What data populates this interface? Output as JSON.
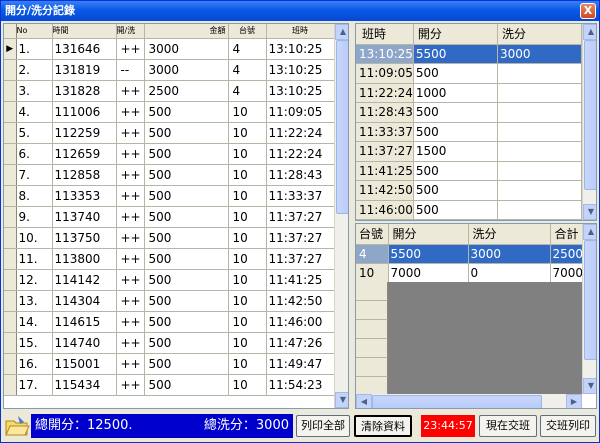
{
  "window": {
    "title": "開分/洗分記錄",
    "close_label": "X"
  },
  "left_table": {
    "headers": [
      "No",
      "時間",
      "開/洗",
      "金額",
      "台號",
      "班時"
    ],
    "rows": [
      [
        "1.",
        "131646",
        "++",
        "3000",
        "4",
        "13:10:25"
      ],
      [
        "2.",
        "131819",
        "--",
        "3000",
        "4",
        "13:10:25"
      ],
      [
        "3.",
        "131828",
        "++",
        "2500",
        "4",
        "13:10:25"
      ],
      [
        "4.",
        "111006",
        "++",
        "500",
        "10",
        "11:09:05"
      ],
      [
        "5.",
        "112259",
        "++",
        "500",
        "10",
        "11:22:24"
      ],
      [
        "6.",
        "112659",
        "++",
        "500",
        "10",
        "11:22:24"
      ],
      [
        "7.",
        "112858",
        "++",
        "500",
        "10",
        "11:28:43"
      ],
      [
        "8.",
        "113353",
        "++",
        "500",
        "10",
        "11:33:37"
      ],
      [
        "9.",
        "113740",
        "++",
        "500",
        "10",
        "11:37:27"
      ],
      [
        "10.",
        "113750",
        "++",
        "500",
        "10",
        "11:37:27"
      ],
      [
        "11.",
        "113800",
        "++",
        "500",
        "10",
        "11:37:27"
      ],
      [
        "12.",
        "114142",
        "++",
        "500",
        "10",
        "11:41:25"
      ],
      [
        "13.",
        "114304",
        "++",
        "500",
        "10",
        "11:42:50"
      ],
      [
        "14.",
        "114615",
        "++",
        "500",
        "10",
        "11:46:00"
      ],
      [
        "15.",
        "114740",
        "++",
        "500",
        "10",
        "11:47:26"
      ],
      [
        "16.",
        "115001",
        "++",
        "500",
        "10",
        "11:49:47"
      ],
      [
        "17.",
        "115434",
        "++",
        "500",
        "10",
        "11:54:23"
      ]
    ]
  },
  "shift_table": {
    "headers": [
      "班時",
      "開分",
      "洗分"
    ],
    "rows": [
      [
        "13:10:25",
        "5500",
        "3000"
      ],
      [
        "11:09:05",
        "500",
        ""
      ],
      [
        "11:22:24",
        "1000",
        ""
      ],
      [
        "11:28:43",
        "500",
        ""
      ],
      [
        "11:33:37",
        "500",
        ""
      ],
      [
        "11:37:27",
        "1500",
        ""
      ],
      [
        "11:41:25",
        "500",
        ""
      ],
      [
        "11:42:50",
        "500",
        ""
      ],
      [
        "11:46:00",
        "500",
        ""
      ]
    ]
  },
  "machine_table": {
    "headers": [
      "台號",
      "開分",
      "洗分",
      "合計"
    ],
    "rows": [
      [
        "4",
        "5500",
        "3000",
        "2500"
      ],
      [
        "10",
        "7000",
        "0",
        "7000"
      ]
    ]
  },
  "status": {
    "open_total": "總開分：12500.",
    "wash_total": "總洗分：3000",
    "clock": "23:44:57"
  },
  "buttons": {
    "print_all": "列印全部",
    "clear_data": "清除資料",
    "current_shift": "現在交班",
    "shift_print": "交班列印"
  },
  "colors": {
    "selection": "#316ac5",
    "status_bar": "#0000cc",
    "clock_bg": "#ff0000"
  }
}
